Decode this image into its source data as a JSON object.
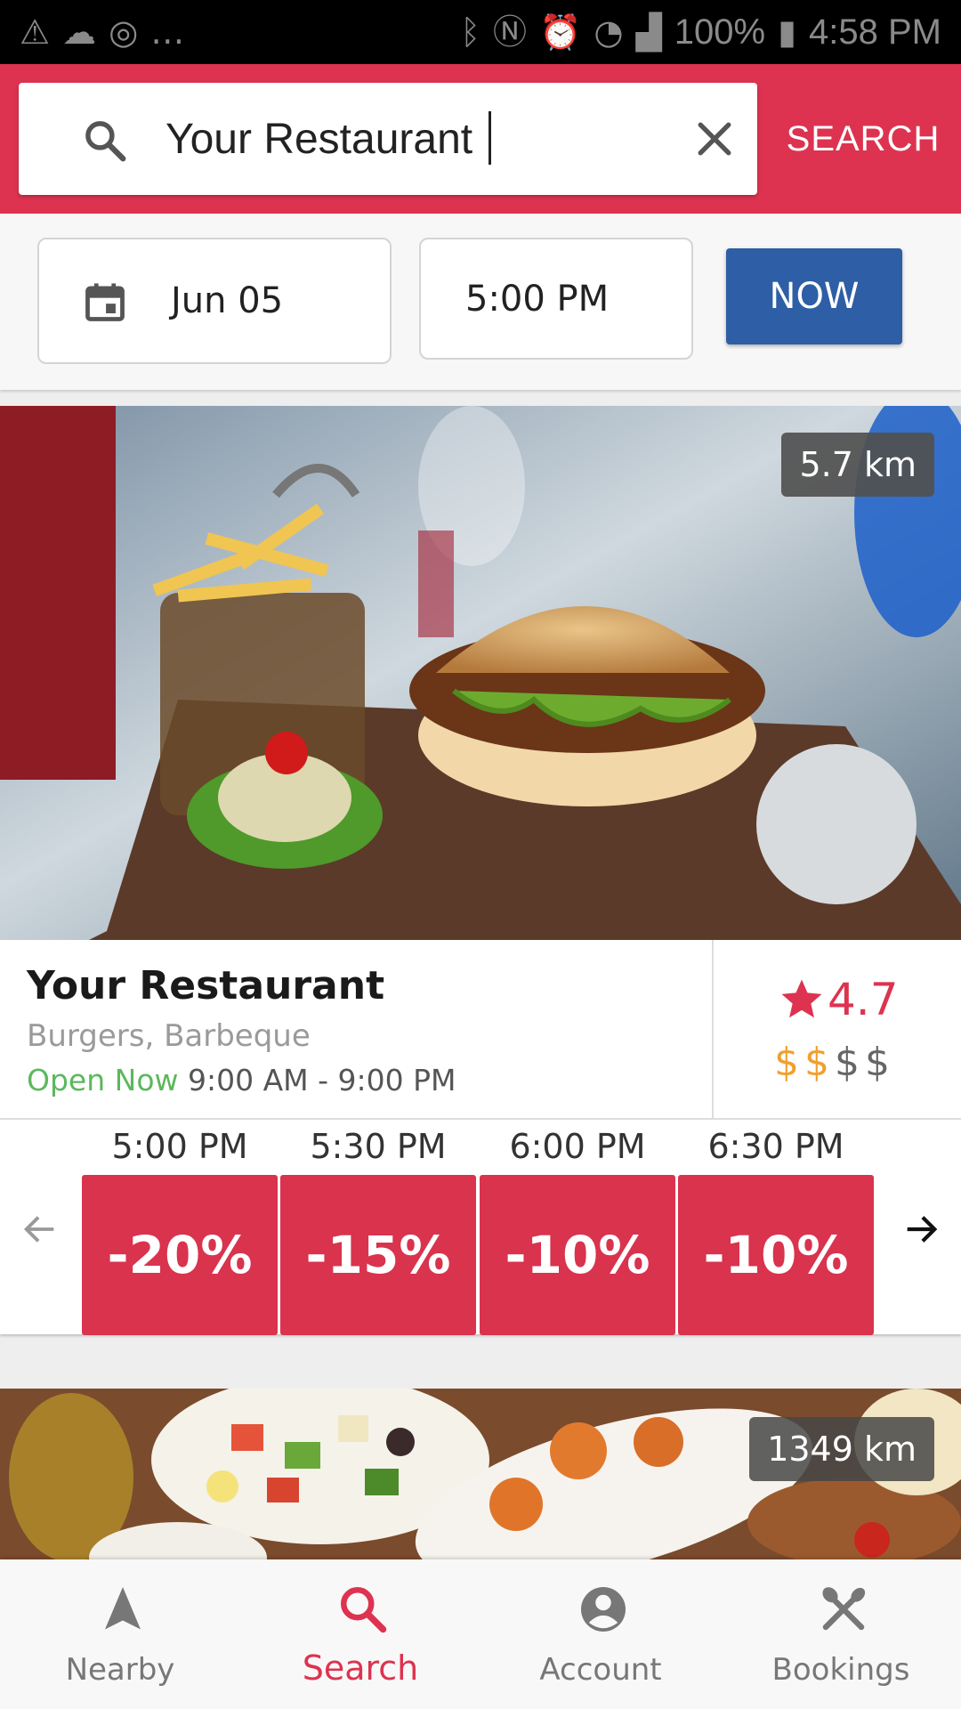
{
  "status_bar": {
    "battery": "100%",
    "time": "4:58 PM"
  },
  "search": {
    "value": "Your Restaurant",
    "button_label": "SEARCH"
  },
  "filters": {
    "date": "Jun 05",
    "time": "5:00 PM",
    "now_label": "NOW"
  },
  "restaurants": [
    {
      "distance": "5.7 km",
      "name": "Your Restaurant",
      "cuisine": "Burgers, Barbeque",
      "open_status": "Open Now",
      "hours": "9:00 AM - 9:00 PM",
      "rating": "4.7",
      "price_symbols": [
        "$",
        "$",
        "$",
        "$"
      ],
      "price_level": 2,
      "slots": [
        {
          "time": "5:00 PM",
          "deal": "-20%"
        },
        {
          "time": "5:30 PM",
          "deal": "-15%"
        },
        {
          "time": "6:00 PM",
          "deal": "-10%"
        },
        {
          "time": "6:30 PM",
          "deal": "-10%"
        }
      ]
    },
    {
      "distance": "1349 km"
    }
  ],
  "nav": {
    "items": [
      {
        "label": "Nearby",
        "icon": "navigation-arrow-icon"
      },
      {
        "label": "Search",
        "icon": "search-icon"
      },
      {
        "label": "Account",
        "icon": "account-circle-icon"
      },
      {
        "label": "Bookings",
        "icon": "cutlery-icon"
      }
    ],
    "active": "Search"
  },
  "colors": {
    "primary": "#dd3350",
    "now_button": "#2e5ea5",
    "open_now": "#5cb85c",
    "price_active": "#f0a030",
    "deal": "#d9334e"
  }
}
